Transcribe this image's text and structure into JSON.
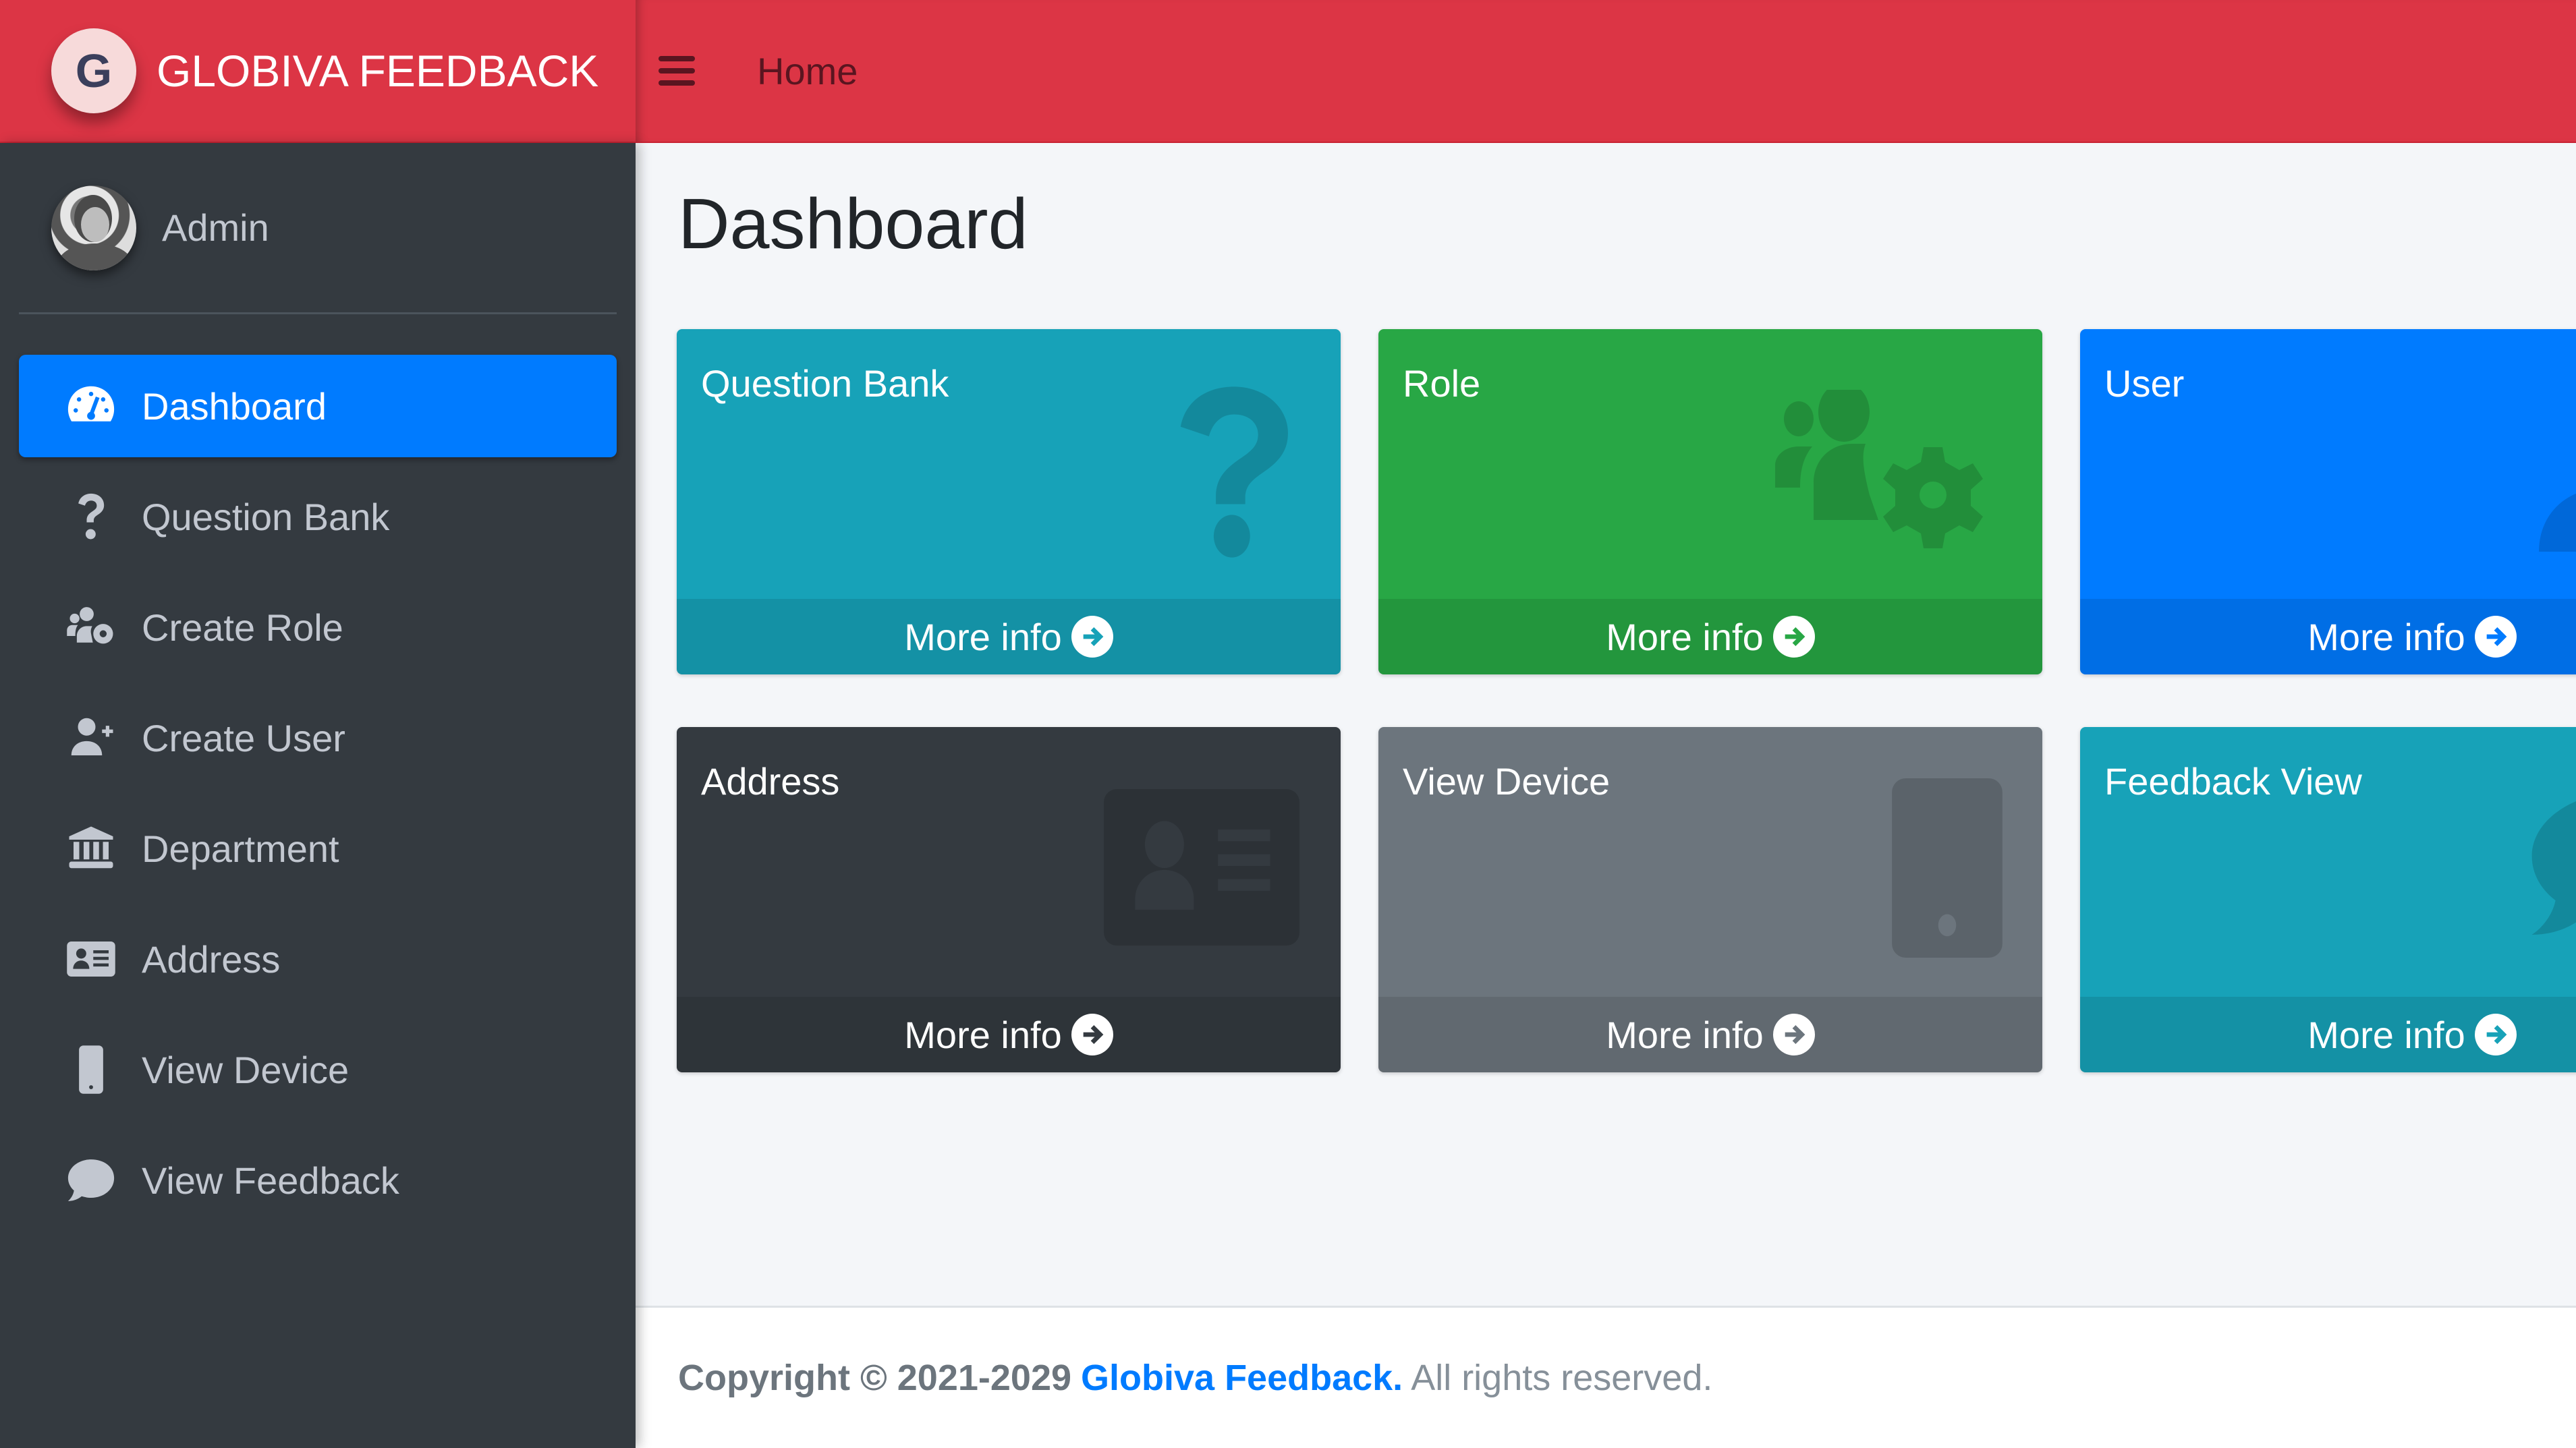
{
  "brand": {
    "name": "GLOBIVA FEEDBACK",
    "logo_letter": "G",
    "color": "#dc3545"
  },
  "navbar": {
    "menu_icon": "hamburger-icon",
    "home_link": "Home"
  },
  "user": {
    "name": "Admin"
  },
  "sidebar": {
    "items": [
      {
        "label": "Dashboard",
        "icon": "tachometer-icon",
        "active": true
      },
      {
        "label": "Question Bank",
        "icon": "question-icon",
        "active": false
      },
      {
        "label": "Create Role",
        "icon": "users-cog-icon",
        "active": false
      },
      {
        "label": "Create User",
        "icon": "user-plus-icon",
        "active": false
      },
      {
        "label": "Department",
        "icon": "university-icon",
        "active": false
      },
      {
        "label": "Address",
        "icon": "address-card-icon",
        "active": false
      },
      {
        "label": "View Device",
        "icon": "mobile-icon",
        "active": false
      },
      {
        "label": "View Feedback",
        "icon": "comment-icon",
        "active": false
      }
    ],
    "active_color": "#007bff"
  },
  "main": {
    "title": "Dashboard",
    "cards": [
      {
        "title": "Question Bank",
        "link": "More info",
        "icon": "question-icon",
        "color": "#17a2b8"
      },
      {
        "title": "Role",
        "link": "More info",
        "icon": "users-cog-icon",
        "color": "#28a745"
      },
      {
        "title": "User",
        "link": "More info",
        "icon": "user-icon",
        "color": "#007bff"
      },
      {
        "title": "Address",
        "link": "More info",
        "icon": "address-card-icon",
        "color": "#343a40"
      },
      {
        "title": "View Device",
        "link": "More info",
        "icon": "mobile-icon",
        "color": "#6c757d"
      },
      {
        "title": "Feedback View",
        "link": "More info",
        "icon": "comment-icon",
        "color": "#17a2b8"
      }
    ]
  },
  "footer": {
    "copyright": "Copyright © 2021-2029",
    "company": "Globiva Feedback.",
    "rights": "All rights reserved."
  }
}
